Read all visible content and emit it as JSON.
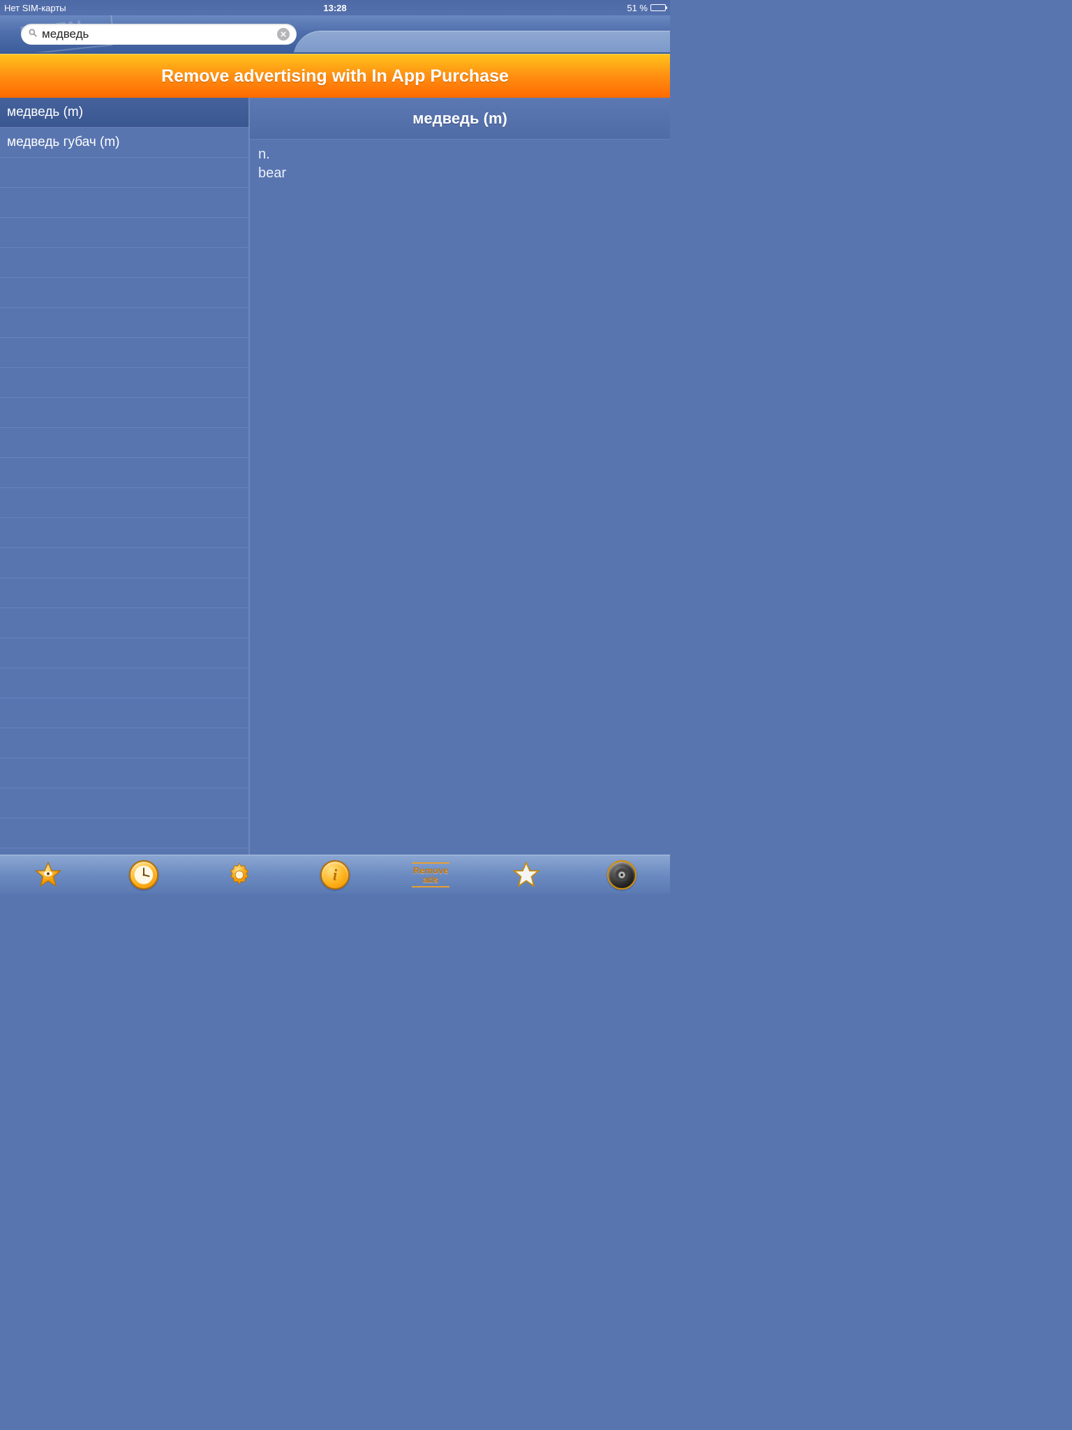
{
  "statusbar": {
    "carrier": "Нет SIM-карты",
    "time": "13:28",
    "battery_percent": "51 %"
  },
  "search": {
    "value": "медведь",
    "watermark": "PORTAL"
  },
  "ad_banner": {
    "text": "Remove advertising with In App Purchase"
  },
  "list": {
    "items": [
      {
        "label": "медведь (m)",
        "selected": true
      },
      {
        "label": "медведь губач (m)",
        "selected": false
      }
    ],
    "empty_rows": 23
  },
  "detail": {
    "title": "медведь (m)",
    "pos": "n.",
    "translation": "bear"
  },
  "tabs": {
    "remove_ads_line1": "Remove",
    "remove_ads_line2": "ads"
  }
}
